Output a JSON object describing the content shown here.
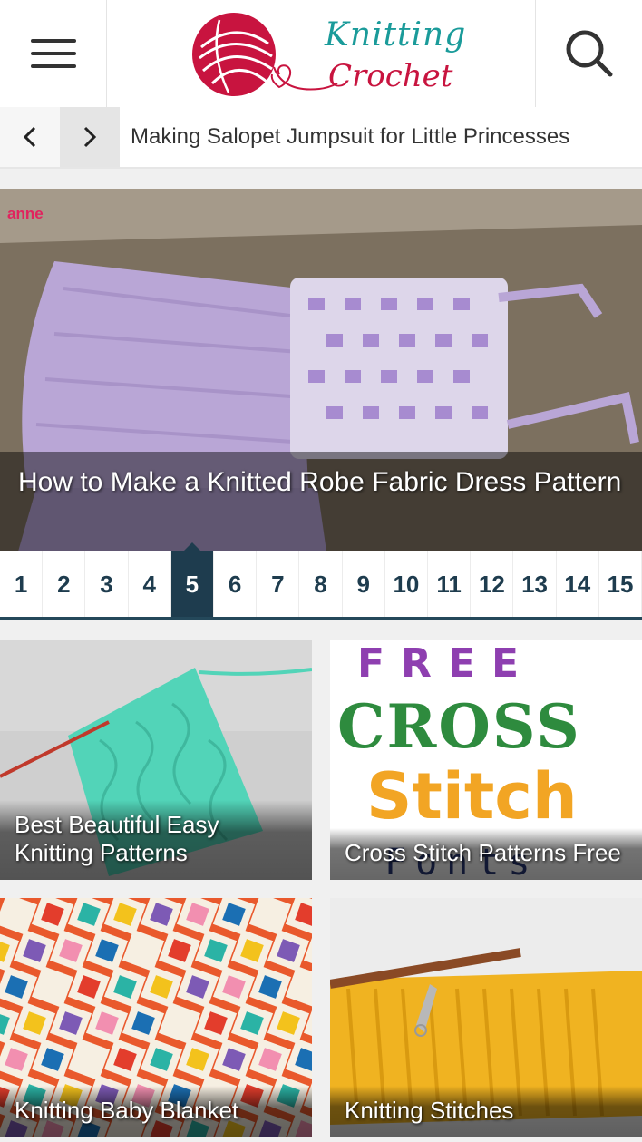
{
  "header": {
    "logo_line1": "Knitting",
    "logo_line2": "Crochet",
    "menu_icon": "hamburger-menu-icon",
    "search_icon": "search-icon"
  },
  "ticker": {
    "prev_icon": "chevron-left-icon",
    "next_icon": "chevron-right-icon",
    "headline": "Making Salopet Jumpsuit for Little Princesses"
  },
  "slider": {
    "watermark": "anne",
    "caption": "How to Make a Knitted Robe Fabric Dress Pattern"
  },
  "pagination": {
    "pages": [
      "1",
      "2",
      "3",
      "4",
      "5",
      "6",
      "7",
      "8",
      "9",
      "10",
      "11",
      "12",
      "13",
      "14",
      "15"
    ],
    "active": "5"
  },
  "cards": [
    {
      "title": "Best Beautiful Easy Knitting Patterns"
    },
    {
      "title": "Cross Stitch Patterns Free"
    },
    {
      "title": "Knitting Baby Blanket"
    },
    {
      "title": "Knitting Stitches"
    }
  ],
  "colors": {
    "brand_red": "#c8143f",
    "brand_teal": "#1a9b9a",
    "pager_dark": "#1e3c4e"
  }
}
